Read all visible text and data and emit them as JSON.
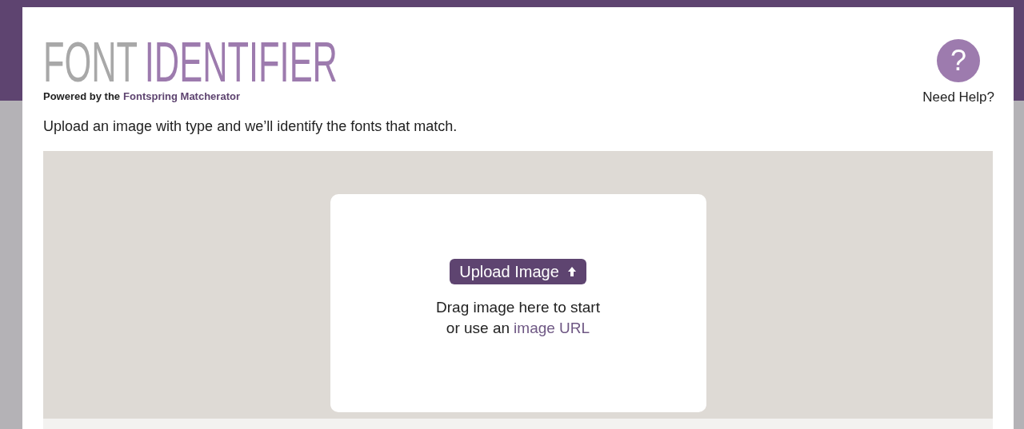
{
  "header": {
    "title_parts": [
      {
        "text": "FONT",
        "kind": "plain"
      },
      {
        "text": "IDENTIFIER",
        "kind": "accent"
      }
    ],
    "tagline": {
      "prefix": "Powered by the",
      "link": "Fontspring Matcherator"
    },
    "help": {
      "icon": "?",
      "label": "Need Help?"
    }
  },
  "intro": "Upload an image with type and we’ll identify the fonts that match.",
  "upload": {
    "button": "Upload Image",
    "hint": "Drag image here to start",
    "alt_prefix": "or use an",
    "alt_link": "image URL"
  }
}
